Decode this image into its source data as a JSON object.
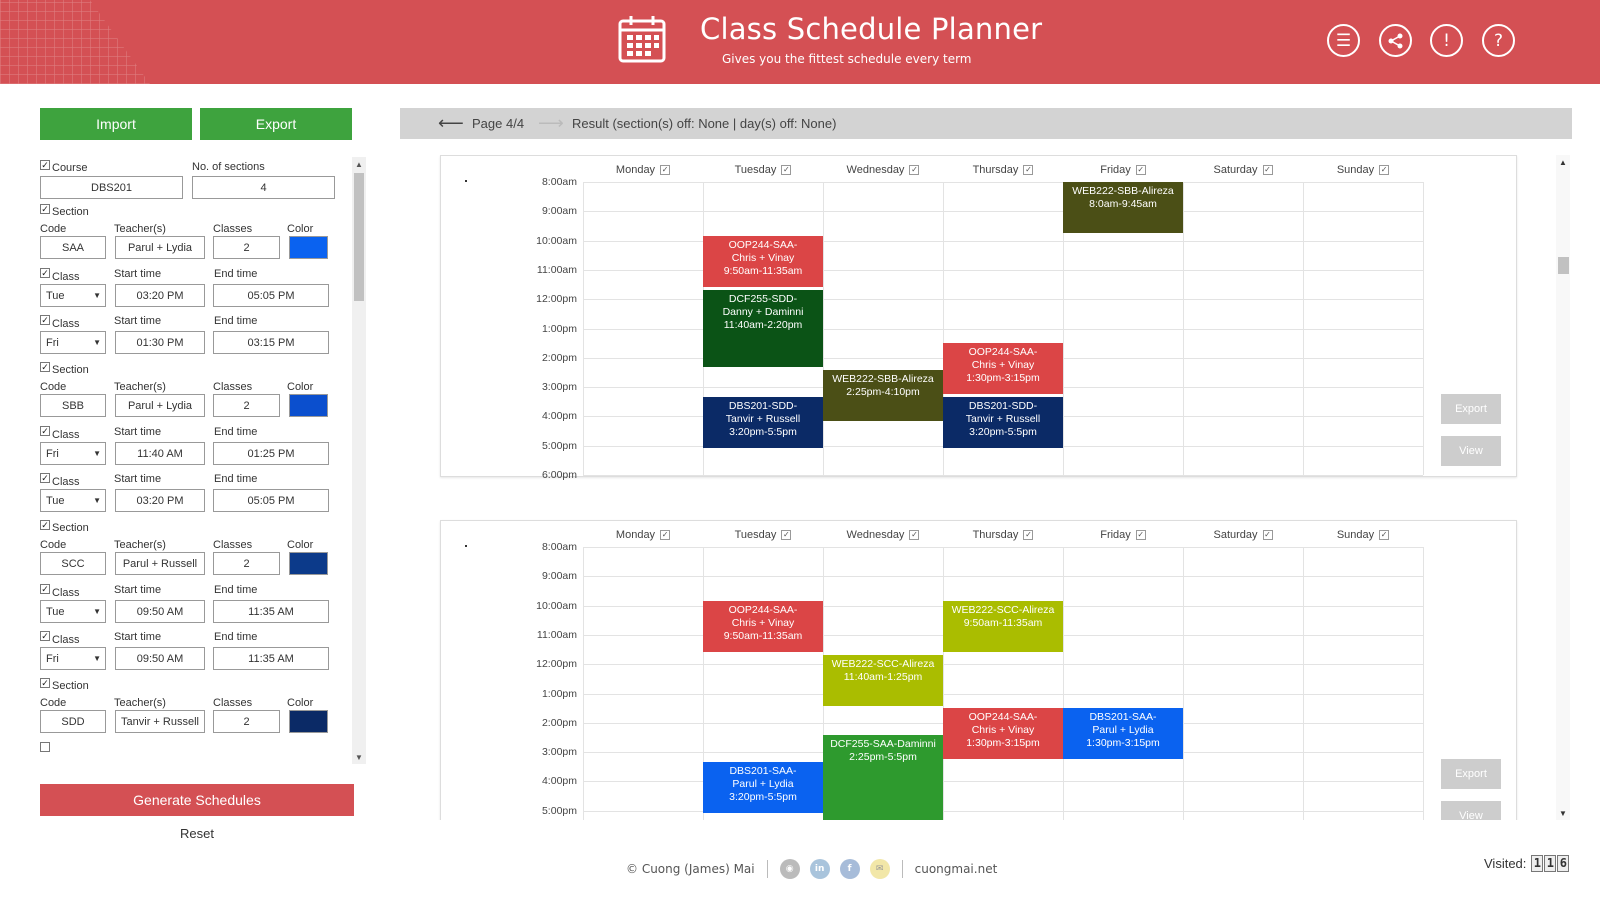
{
  "header": {
    "title": "Class Schedule Planner",
    "subtitle": "Gives you the fittest schedule every term",
    "buttons": [
      "menu-icon",
      "share-icon",
      "info-icon",
      "help-icon"
    ]
  },
  "sidebar": {
    "import_label": "Import",
    "export_label": "Export",
    "course_label": "Course",
    "sections_count_label": "No. of sections",
    "course_code": "DBS201",
    "sections_count": "4",
    "labels": {
      "section": "Section",
      "code": "Code",
      "teachers": "Teacher(s)",
      "classes": "Classes",
      "color": "Color",
      "class": "Class",
      "start_time": "Start time",
      "end_time": "End time"
    },
    "sections": [
      {
        "code": "SAA",
        "teachers": "Parul + Lydia",
        "classes": "2",
        "color": "#0a62f0",
        "class_rows": [
          {
            "day": "Tue",
            "start": "03:20 PM",
            "end": "05:05 PM"
          },
          {
            "day": "Fri",
            "start": "01:30 PM",
            "end": "03:15 PM"
          }
        ]
      },
      {
        "code": "SBB",
        "teachers": "Parul + Lydia",
        "classes": "2",
        "color": "#0b4fce",
        "class_rows": [
          {
            "day": "Fri",
            "start": "11:40 AM",
            "end": "01:25 PM"
          },
          {
            "day": "Tue",
            "start": "03:20 PM",
            "end": "05:05 PM"
          }
        ]
      },
      {
        "code": "SCC",
        "teachers": "Parul + Russell",
        "classes": "2",
        "color": "#0c3a8a",
        "class_rows": [
          {
            "day": "Tue",
            "start": "09:50 AM",
            "end": "11:35 AM"
          },
          {
            "day": "Fri",
            "start": "09:50 AM",
            "end": "11:35 AM"
          }
        ]
      },
      {
        "code": "SDD",
        "teachers": "Tanvir + Russell",
        "classes": "2",
        "color": "#0b2a66",
        "class_rows": []
      }
    ],
    "generate_label": "Generate Schedules",
    "reset_label": "Reset"
  },
  "result_bar": {
    "page": "Page 4/4",
    "result": "Result (section(s) off: None | day(s) off: None)"
  },
  "days": [
    "Monday",
    "Tuesday",
    "Wednesday",
    "Thursday",
    "Friday",
    "Saturday",
    "Sunday"
  ],
  "times": [
    "8:00am",
    "9:00am",
    "10:00am",
    "11:00am",
    "12:00pm",
    "1:00pm",
    "2:00pm",
    "3:00pm",
    "4:00pm",
    "5:00pm",
    "6:00pm"
  ],
  "schedules": [
    {
      "events": [
        {
          "day": 4,
          "start": 8.0,
          "end": 9.75,
          "color": "#4b4f16",
          "lines": [
            "WEB222-SBB-Alireza",
            "8:0am-9:45am"
          ]
        },
        {
          "day": 1,
          "start": 9.83,
          "end": 11.58,
          "color": "#db4546",
          "lines": [
            "OOP244-SAA-",
            "Chris + Vinay",
            "9:50am-11:35am"
          ]
        },
        {
          "day": 1,
          "start": 11.67,
          "end": 14.33,
          "color": "#0b5316",
          "lines": [
            "DCF255-SDD-",
            "Danny + Daminni",
            "11:40am-2:20pm"
          ]
        },
        {
          "day": 3,
          "start": 13.5,
          "end": 15.25,
          "color": "#db4546",
          "lines": [
            "OOP244-SAA-",
            "Chris + Vinay",
            "1:30pm-3:15pm"
          ]
        },
        {
          "day": 2,
          "start": 14.42,
          "end": 16.17,
          "color": "#4b4f16",
          "lines": [
            "WEB222-SBB-Alireza",
            "2:25pm-4:10pm"
          ]
        },
        {
          "day": 1,
          "start": 15.33,
          "end": 17.08,
          "color": "#0b2a66",
          "lines": [
            "DBS201-SDD-",
            "Tanvir + Russell",
            "3:20pm-5:5pm"
          ]
        },
        {
          "day": 3,
          "start": 15.33,
          "end": 17.08,
          "color": "#0b2a66",
          "lines": [
            "DBS201-SDD-",
            "Tanvir + Russell",
            "3:20pm-5:5pm"
          ]
        }
      ],
      "export_label": "Export",
      "view_label": "View"
    },
    {
      "events": [
        {
          "day": 1,
          "start": 9.83,
          "end": 11.58,
          "color": "#db4546",
          "lines": [
            "OOP244-SAA-",
            "Chris + Vinay",
            "9:50am-11:35am"
          ]
        },
        {
          "day": 3,
          "start": 9.83,
          "end": 11.58,
          "color": "#aabd00",
          "lines": [
            "WEB222-SCC-Alireza",
            "9:50am-11:35am"
          ]
        },
        {
          "day": 2,
          "start": 11.67,
          "end": 13.42,
          "color": "#aabd00",
          "lines": [
            "WEB222-SCC-Alireza",
            "11:40am-1:25pm"
          ]
        },
        {
          "day": 3,
          "start": 13.5,
          "end": 15.25,
          "color": "#db4546",
          "lines": [
            "OOP244-SAA-",
            "Chris + Vinay",
            "1:30pm-3:15pm"
          ]
        },
        {
          "day": 4,
          "start": 13.5,
          "end": 15.25,
          "color": "#0a62f0",
          "lines": [
            "DBS201-SAA-",
            "Parul + Lydia",
            "1:30pm-3:15pm"
          ]
        },
        {
          "day": 2,
          "start": 14.42,
          "end": 17.5,
          "color": "#2e9a2e",
          "lines": [
            "DCF255-SAA-Daminni",
            "2:25pm-5:5pm"
          ]
        },
        {
          "day": 1,
          "start": 15.33,
          "end": 17.08,
          "color": "#0a62f0",
          "lines": [
            "DBS201-SAA-",
            "Parul + Lydia",
            "3:20pm-5:5pm"
          ]
        }
      ],
      "export_label": "Export",
      "view_label": "View"
    }
  ],
  "footer": {
    "author": "© Cuong (James) Mai",
    "site": "cuongmai.net",
    "icons": [
      "github-icon",
      "linkedin-icon",
      "facebook-icon",
      "email-icon"
    ],
    "visited_label": "Visited:",
    "visited_digits": [
      "1",
      "1",
      "6"
    ]
  }
}
